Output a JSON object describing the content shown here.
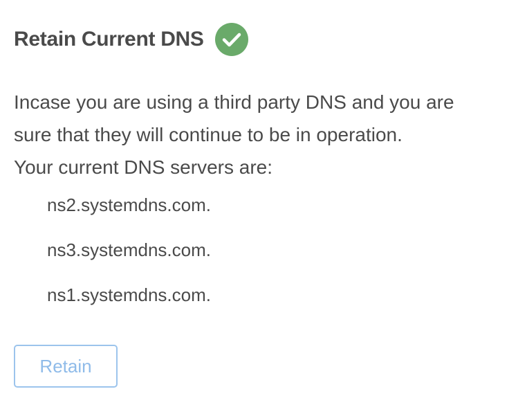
{
  "header": {
    "title": "Retain Current DNS",
    "status_icon": "check-circle-icon",
    "status_color": "#6aaa6a"
  },
  "description": {
    "line1": "Incase you are using a third party DNS and you are",
    "line2": "sure that they will continue to be in operation.",
    "line3": "Your current DNS servers are:"
  },
  "dns_servers": [
    "ns2.systemdns.com.",
    "ns3.systemdns.com.",
    "ns1.systemdns.com."
  ],
  "actions": {
    "retain_label": "Retain",
    "accent_color": "#8fbbe9"
  }
}
